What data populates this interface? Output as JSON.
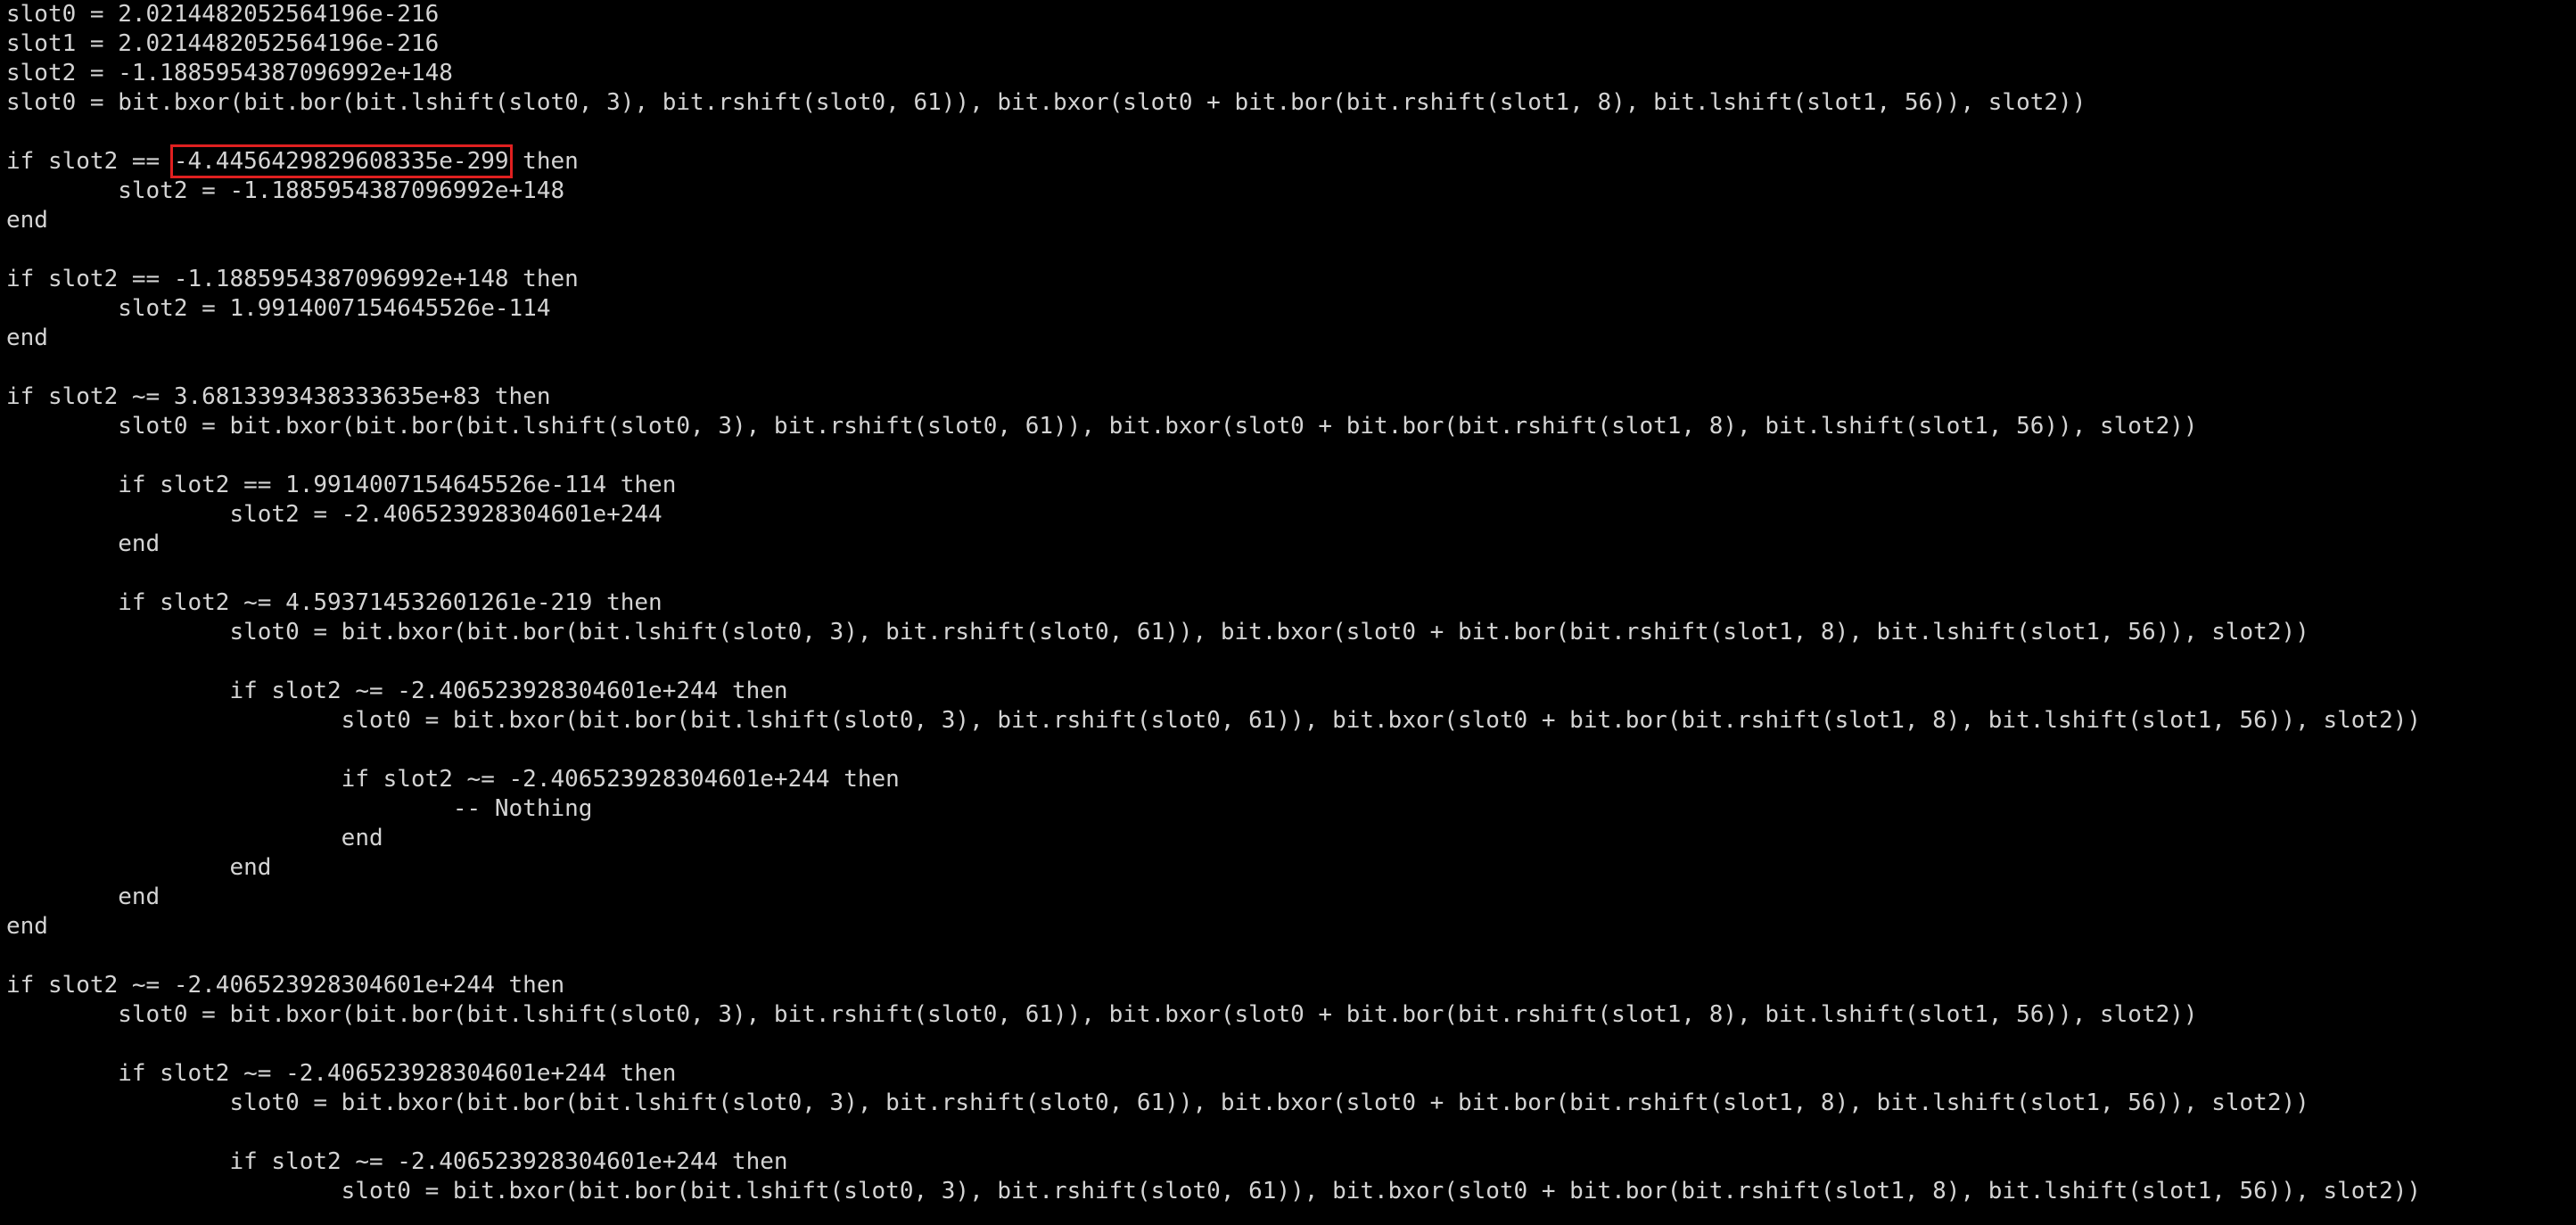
{
  "colors": {
    "background": "#000000",
    "text": "#d4d4d4",
    "highlight_box": "#e02020"
  },
  "lines": [
    {
      "text": "slot0 = 2.0214482052564196e-216"
    },
    {
      "text": "slot1 = 2.0214482052564196e-216"
    },
    {
      "text": "slot2 = -1.1885954387096992e+148"
    },
    {
      "text": "slot0 = bit.bxor(bit.bor(bit.lshift(slot0, 3), bit.rshift(slot0, 61)), bit.bxor(slot0 + bit.bor(bit.rshift(slot1, 8), bit.lshift(slot1, 56)), slot2))"
    },
    {
      "text": ""
    },
    {
      "pre": "if slot2 == ",
      "highlight": "-4.4456429829608335e-299",
      "post": " then"
    },
    {
      "text": "        slot2 = -1.1885954387096992e+148"
    },
    {
      "text": "end"
    },
    {
      "text": ""
    },
    {
      "text": "if slot2 == -1.1885954387096992e+148 then"
    },
    {
      "text": "        slot2 = 1.9914007154645526e-114"
    },
    {
      "text": "end"
    },
    {
      "text": ""
    },
    {
      "text": "if slot2 ~= 3.6813393438333635e+83 then"
    },
    {
      "text": "        slot0 = bit.bxor(bit.bor(bit.lshift(slot0, 3), bit.rshift(slot0, 61)), bit.bxor(slot0 + bit.bor(bit.rshift(slot1, 8), bit.lshift(slot1, 56)), slot2))"
    },
    {
      "text": ""
    },
    {
      "text": "        if slot2 == 1.9914007154645526e-114 then"
    },
    {
      "text": "                slot2 = -2.406523928304601e+244"
    },
    {
      "text": "        end"
    },
    {
      "text": ""
    },
    {
      "text": "        if slot2 ~= 4.593714532601261e-219 then"
    },
    {
      "text": "                slot0 = bit.bxor(bit.bor(bit.lshift(slot0, 3), bit.rshift(slot0, 61)), bit.bxor(slot0 + bit.bor(bit.rshift(slot1, 8), bit.lshift(slot1, 56)), slot2))"
    },
    {
      "text": ""
    },
    {
      "text": "                if slot2 ~= -2.406523928304601e+244 then"
    },
    {
      "text": "                        slot0 = bit.bxor(bit.bor(bit.lshift(slot0, 3), bit.rshift(slot0, 61)), bit.bxor(slot0 + bit.bor(bit.rshift(slot1, 8), bit.lshift(slot1, 56)), slot2))"
    },
    {
      "text": ""
    },
    {
      "text": "                        if slot2 ~= -2.406523928304601e+244 then"
    },
    {
      "text": "                                -- Nothing"
    },
    {
      "text": "                        end"
    },
    {
      "text": "                end"
    },
    {
      "text": "        end"
    },
    {
      "text": "end"
    },
    {
      "text": ""
    },
    {
      "text": "if slot2 ~= -2.406523928304601e+244 then"
    },
    {
      "text": "        slot0 = bit.bxor(bit.bor(bit.lshift(slot0, 3), bit.rshift(slot0, 61)), bit.bxor(slot0 + bit.bor(bit.rshift(slot1, 8), bit.lshift(slot1, 56)), slot2))"
    },
    {
      "text": ""
    },
    {
      "text": "        if slot2 ~= -2.406523928304601e+244 then"
    },
    {
      "text": "                slot0 = bit.bxor(bit.bor(bit.lshift(slot0, 3), bit.rshift(slot0, 61)), bit.bxor(slot0 + bit.bor(bit.rshift(slot1, 8), bit.lshift(slot1, 56)), slot2))"
    },
    {
      "text": ""
    },
    {
      "text": "                if slot2 ~= -2.406523928304601e+244 then"
    },
    {
      "text": "                        slot0 = bit.bxor(bit.bor(bit.lshift(slot0, 3), bit.rshift(slot0, 61)), bit.bxor(slot0 + bit.bor(bit.rshift(slot1, 8), bit.lshift(slot1, 56)), slot2))"
    }
  ]
}
